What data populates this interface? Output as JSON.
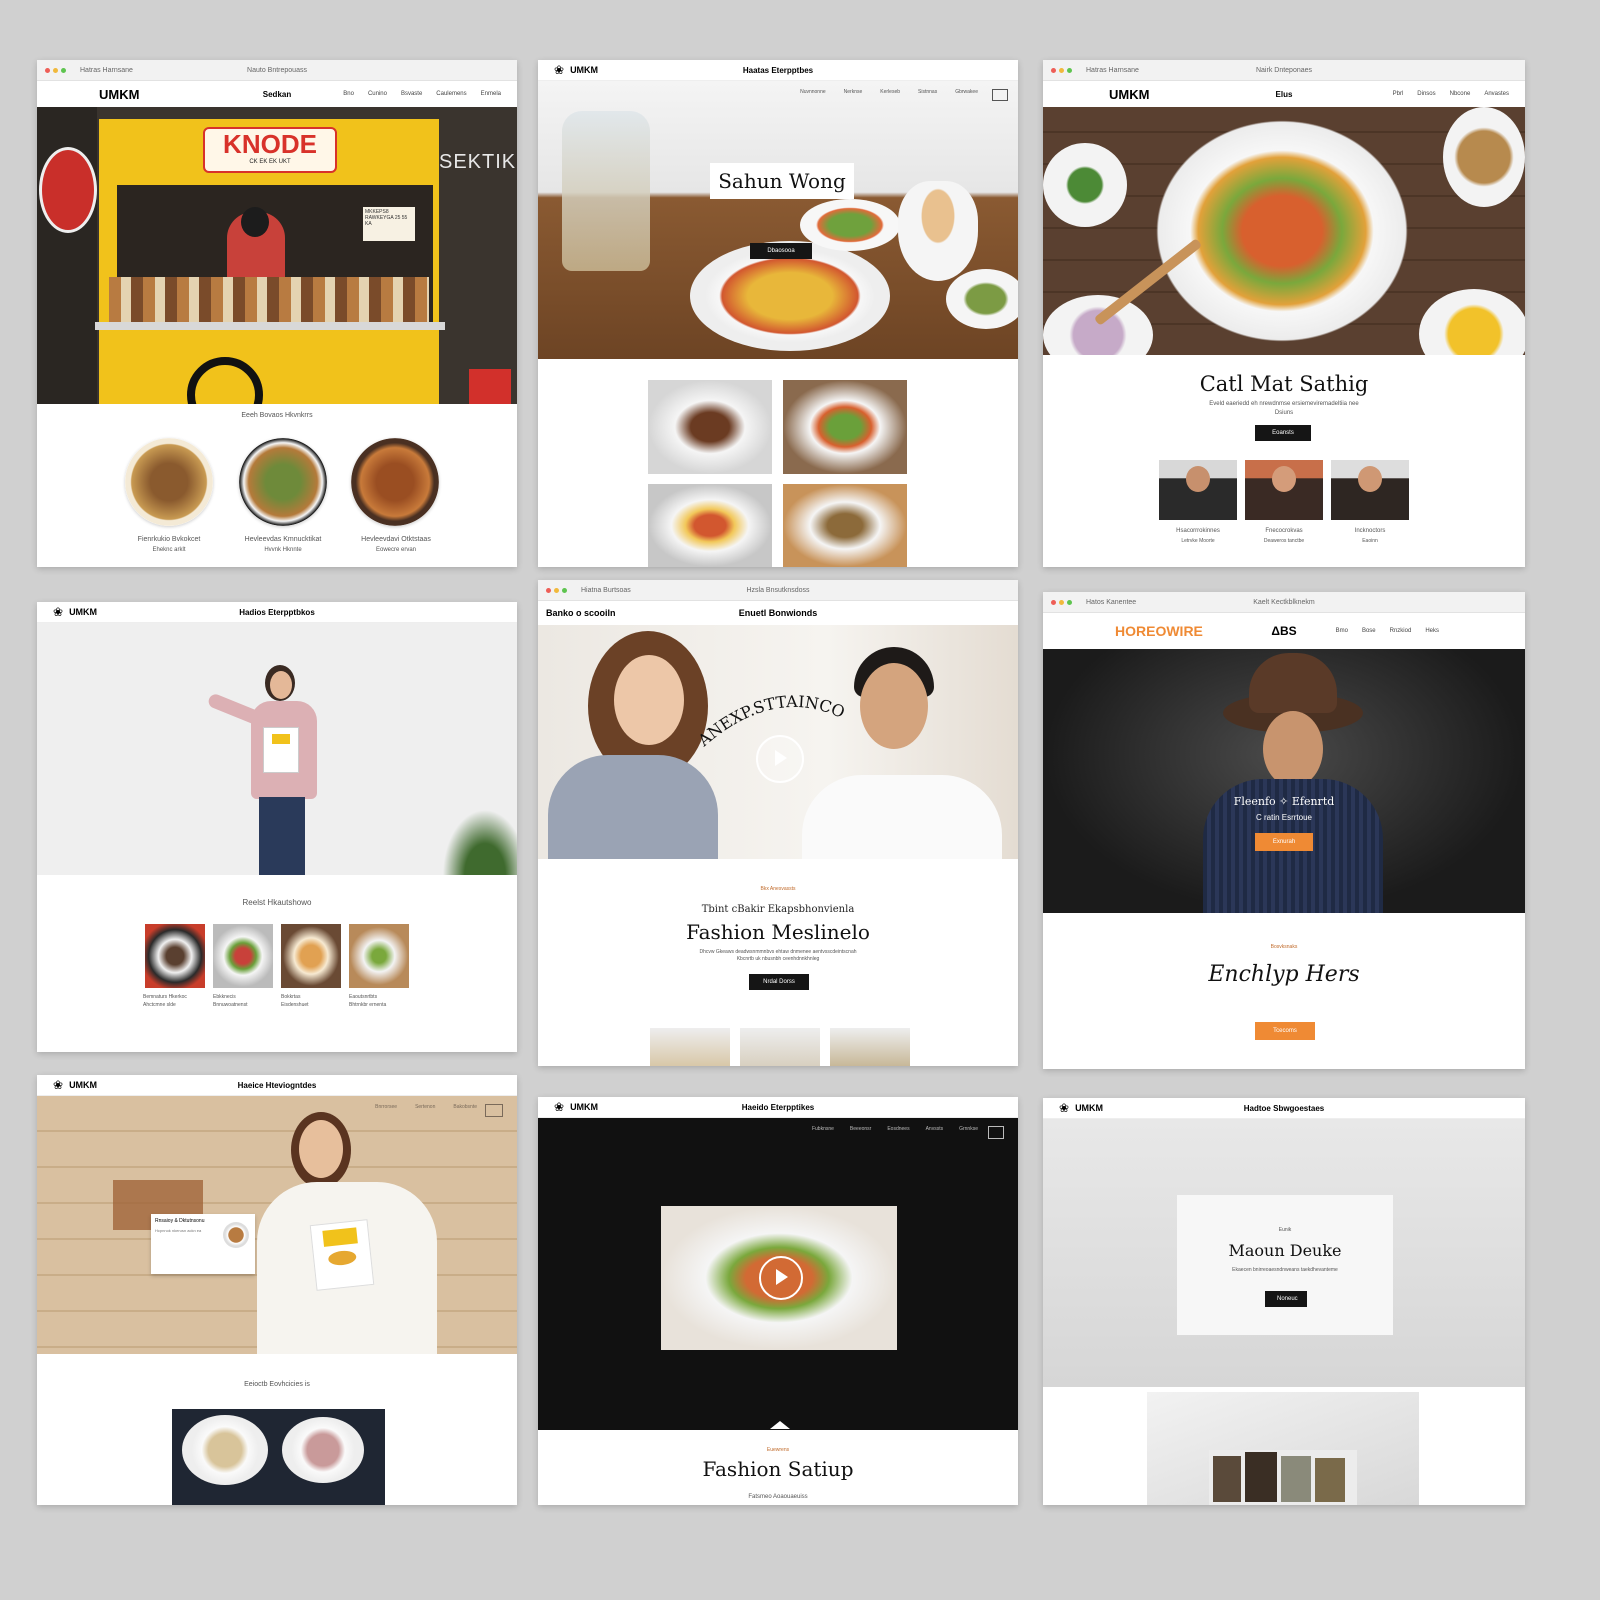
{
  "cards": {
    "c1": {
      "url": "Hatras Harnsane",
      "address": "Nauto Bntrepouass",
      "brand": "UMKM",
      "nav_center": "Sedkan",
      "nav_links": [
        "Bno",
        "Cunino",
        "Bsvaste",
        "Caulemens",
        "Enmela"
      ],
      "sign": "KNODE",
      "sign_sub": "CK  EK  EK  UKT",
      "side_sign": "SEKTIK",
      "menu_board": "MKKEPS8 RAWKEYGA 25 55 KA",
      "section_title": "Eeeh Bovaos Hkvnkrrs",
      "items": [
        {
          "name": "Fienrkukio Bvkokcet",
          "sub": "Eheknc arklt"
        },
        {
          "name": "Hevleevdas Kmnucktikat",
          "sub": "Hvvnk Hknnte"
        },
        {
          "name": "Hevleevdavi Otktstaas",
          "sub": "Eowecre ervan"
        }
      ]
    },
    "c2": {
      "brand": "UMKM",
      "address": "Haatas Eterpptbes",
      "nav_links": [
        "Nuvnnonne",
        "Nerknse",
        "Kerleseb",
        "Sistnnas",
        "Gbrwakee"
      ],
      "hero_title": "Sahun Wong",
      "hero_button": "Dbaosooa"
    },
    "c3": {
      "url": "Hatras Harnsane",
      "address": "Nairk Dnteponaes",
      "brand": "UMKM",
      "nav_center": "Elus",
      "nav_links": [
        "Pbrl",
        "Dinsos",
        "Nbcone",
        "Anvastes"
      ],
      "title": "Catl Mat Sathig",
      "sub": "Eveld eaeriedd eh nrewdnmse ersiemeviremadeltiia nee",
      "sub2": "Dsiuns",
      "button": "Eoansts",
      "people": [
        {
          "name": "Hsacorrrokinnes",
          "sub": "Letrvke Moorte"
        },
        {
          "name": "Fnecocrokvas",
          "sub": "Deaweros tanctbe"
        },
        {
          "name": "Incknoctors",
          "sub": "Eaoinn"
        }
      ]
    },
    "c4": {
      "brand": "UMKM",
      "address": "Hadios Eterpptbkos",
      "section_title": "Reelst Hkautshowo",
      "items": [
        {
          "name": "Bemnaturs Hkerkoc",
          "sub": "Ahctcmne slde"
        },
        {
          "name": "Ebkknecis",
          "sub": "Bnnuwoatnenst"
        },
        {
          "name": "Bokkrtas",
          "sub": "Eisdenshuet"
        },
        {
          "name": "Eaoutsnrtbts",
          "sub": "Bhtrnkbr ernenta"
        }
      ]
    },
    "c5": {
      "url": "Hiatna Burtsoas",
      "address": "Hzsla Bnsutknsdoss",
      "left": "Banko o scooiln",
      "right": "Enuetl Bonwionds",
      "arc": "ANEXP.STTAINCO",
      "kicker": "Bkx Anesvassts",
      "lead": "Tbint cBakir Ekapsbhonvienla",
      "title": "Fashion Meslinelo",
      "body1": "Dhcvw Gkeaws deadwsnmmnbvs ehtaw dnmenee aentvsscdeintscnah",
      "body2": "Kbcnrtb uk nbusnbh ceenhdnnkhnleg",
      "button": "Nrdal Dorss"
    },
    "c6": {
      "url": "Hatos Kanentee",
      "address": "Kaelt Kectkblknekm",
      "brand": "HOREOWIRE",
      "brand_center": "ΔBS",
      "nav_links": [
        "Bmo",
        "Bose",
        "Rnzkiod",
        "Heks"
      ],
      "hero_l1": "Fleenfo ✧ Efenrtd",
      "hero_l2": "C ratin Esrrtoue",
      "hero_button": "Exnurah",
      "kicker": "Bosvksnaks",
      "title": "Enchlyp Hers",
      "button": "Tcecoms"
    },
    "c7": {
      "brand": "UMKM",
      "address": "Haeice Hteviogntdes",
      "nav_links": [
        "Bnrrorsee",
        "Sertenon",
        "Bakobsnte"
      ],
      "section_title": "Eeioctb Eovhcicies is",
      "menu_title": "Rnsaioy & Dktutnsonu",
      "menu_body": "Hcpnnok nkerusn ackn ea"
    },
    "c8": {
      "brand": "UMKM",
      "address": "Haeido Eterpptikes",
      "nav_links": [
        "Fubknsne",
        "Beeeonsr",
        "Eosdnees",
        "Anvssts",
        "Grnnkse"
      ],
      "kicker": "Euewrens",
      "title": "Fashion Satiup",
      "sub": "Fatsmeo Aoaouaeuiss"
    },
    "c9": {
      "brand": "UMKM",
      "address": "Hadtoe Sbwgoestaes",
      "kicker": "Eunik",
      "title": "Maoun Deuke",
      "sub": "Ekaecen bnirreoaesndnweans taekdhevanteme",
      "button": "Noneuc"
    }
  },
  "colors": {
    "accent_orange": "#ef8a34",
    "food_truck_yellow": "#f1c21b",
    "sign_red": "#d8322a",
    "dark_hero": "#111111"
  },
  "icons": [
    "play-icon",
    "menu-icon",
    "cart-icon",
    "camera-icon",
    "window-dots-icon"
  ]
}
